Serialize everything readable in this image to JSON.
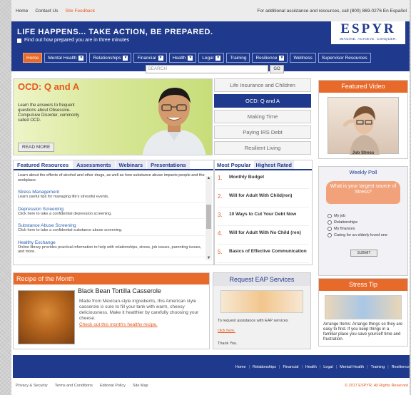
{
  "topbar": {
    "links": [
      "Home",
      "Contact Us",
      "Site Feedback"
    ],
    "assist": "For additional assistance and resources, call (800) 869-0276     En Español"
  },
  "header": {
    "tagline": "LIFE HAPPENS... TAKE ACTION, BE PREPARED.",
    "subline": "Find out how prepared you are in three minutes",
    "logo_name": "ESPYR",
    "logo_tagline": "IMAGINE. ACHIEVE. CONQUER."
  },
  "nav": {
    "items": [
      {
        "label": "Home",
        "dd": false
      },
      {
        "label": "Mental Health",
        "dd": true
      },
      {
        "label": "Relationships",
        "dd": true
      },
      {
        "label": "Financial",
        "dd": true
      },
      {
        "label": "Health",
        "dd": true
      },
      {
        "label": "Legal",
        "dd": true
      },
      {
        "label": "Training",
        "dd": false
      },
      {
        "label": "Resilience",
        "dd": true
      },
      {
        "label": "Wellness",
        "dd": false
      },
      {
        "label": "Supervisor Resources",
        "dd": false
      }
    ]
  },
  "search": {
    "placeholder": "SEARCH",
    "go": "GO"
  },
  "hero": {
    "title": "OCD: Q and A",
    "desc": "Learn the answers to frequent questions about Obsessive-Compulsive Disorder, commonly called OCD.",
    "more": "READ MORE",
    "menu": [
      "Life Insurance and Children",
      "OCD: Q and A",
      "Making Time",
      "Paying IRS Debt",
      "Resilient Living"
    ]
  },
  "featured": {
    "tabs": [
      "Featured Resources",
      "Assessments",
      "Webinars",
      "Presentations"
    ],
    "intro": "Learn about the effects of alcohol and other drugs, as well as how substance abuse impacts people and the workplace.",
    "items": [
      {
        "h": "Stress Management",
        "d": "Learn useful tips for managing life's stressful events."
      },
      {
        "h": "Depression Screening",
        "d": "Click here to take a confidential depression screening."
      },
      {
        "h": "Substance Abuse Screening",
        "d": "Click here to take a confidential substance abuse screening."
      },
      {
        "h": "Healthy Exchange",
        "d": "Online library provides practical information to help with relationships, stress, job issues, parenting issues, and more."
      }
    ]
  },
  "popular": {
    "tabs": [
      "Most Popular",
      "Highest Rated"
    ],
    "items": [
      {
        "n": "1.",
        "t": "Monthly Budget"
      },
      {
        "n": "2.",
        "t": "Will for Adult With Child(ren)"
      },
      {
        "n": "3.",
        "t": "10 Ways to Cut Your Debt Now"
      },
      {
        "n": "4.",
        "t": "Will for Adult With No Child (ren)"
      },
      {
        "n": "5.",
        "t": "Basics of Effective Communication"
      }
    ]
  },
  "video": {
    "title": "Featured Video",
    "label": "Job Stress"
  },
  "poll": {
    "title": "Weekly Poll",
    "question": "What is your largest source of Stress?",
    "options": [
      "My job",
      "Relationships",
      "My finances",
      "Caring for an elderly loved one"
    ],
    "submit": "SUBMIT"
  },
  "recipe": {
    "header": "Recipe of the Month",
    "title": "Black Bean Tortilla Casserole",
    "desc": "Made from Mexican-style ingredients, this American style casserole is sure to fill your tank with warm, cheesy deliciousness. Make it healthier by carefully choosing your cheese.",
    "link": "Check out this month's healthy recipe."
  },
  "eap": {
    "header": "Request EAP Services",
    "text": "To request assistance with EAP services",
    "link": "click here.",
    "thanks": "Thank You."
  },
  "tip": {
    "header": "Stress Tip",
    "text": "Arrange Items: Arrange things so they are easy to find. If you keep things in a familiar place you save yourself time and frustration."
  },
  "footer": {
    "links": [
      "Home",
      "Relationships",
      "Financial",
      "Health",
      "Legal",
      "Mental Health",
      "Training",
      "Resilience"
    ]
  },
  "bottom": {
    "links": [
      "Privacy & Security",
      "Terms and Conditions",
      "Editorial Policy",
      "Site Map"
    ],
    "copyright": "© 2017 ESPYR. All Rights Reserved"
  }
}
